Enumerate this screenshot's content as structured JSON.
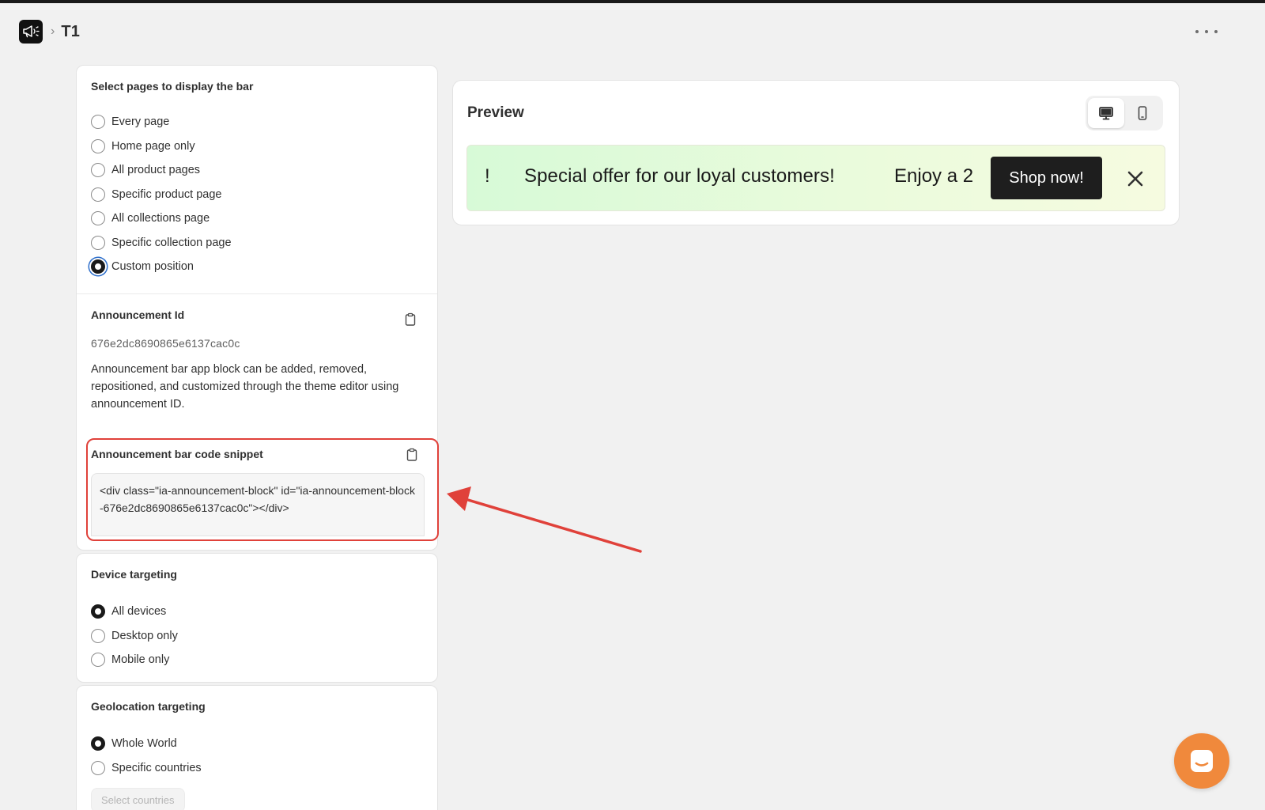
{
  "header": {
    "title": "T1",
    "breadcrumb_sep": "›"
  },
  "pages_section": {
    "title": "Select pages to display the bar",
    "options": [
      {
        "label": "Every page",
        "checked": false
      },
      {
        "label": "Home page only",
        "checked": false
      },
      {
        "label": "All product pages",
        "checked": false
      },
      {
        "label": "Specific product page",
        "checked": false
      },
      {
        "label": "All collections page",
        "checked": false
      },
      {
        "label": "Specific collection page",
        "checked": false
      },
      {
        "label": "Custom position",
        "checked": true
      }
    ]
  },
  "announcement_id": {
    "title": "Announcement Id",
    "value": "676e2dc8690865e6137cac0c",
    "description": "Announcement bar app block can be added, removed, repositioned, and customized through the theme editor using announcement ID."
  },
  "snippet": {
    "title": "Announcement bar code snippet",
    "code": "<div class=\"ia-announcement-block\" id=\"ia-announcement-block-676e2dc8690865e6137cac0c\"></div>"
  },
  "device_targeting": {
    "title": "Device targeting",
    "options": [
      {
        "label": "All devices",
        "checked": true
      },
      {
        "label": "Desktop only",
        "checked": false
      },
      {
        "label": "Mobile only",
        "checked": false
      }
    ]
  },
  "geo_targeting": {
    "title": "Geolocation targeting",
    "options": [
      {
        "label": "Whole World",
        "checked": true
      },
      {
        "label": "Specific countries",
        "checked": false
      }
    ],
    "select_button": "Select countries"
  },
  "preview": {
    "title": "Preview",
    "bar_prefix": "!",
    "bar_text": "Special offer for our loyal customers!",
    "bar_text_2": "Enjoy a 2",
    "cta_label": "Shop now!",
    "bar_gradient": [
      "#d7fad7",
      "#f6fbe0"
    ]
  },
  "colors": {
    "highlight": "#e0413a",
    "chat": "#f0893c",
    "focus": "#2c6ecb"
  }
}
